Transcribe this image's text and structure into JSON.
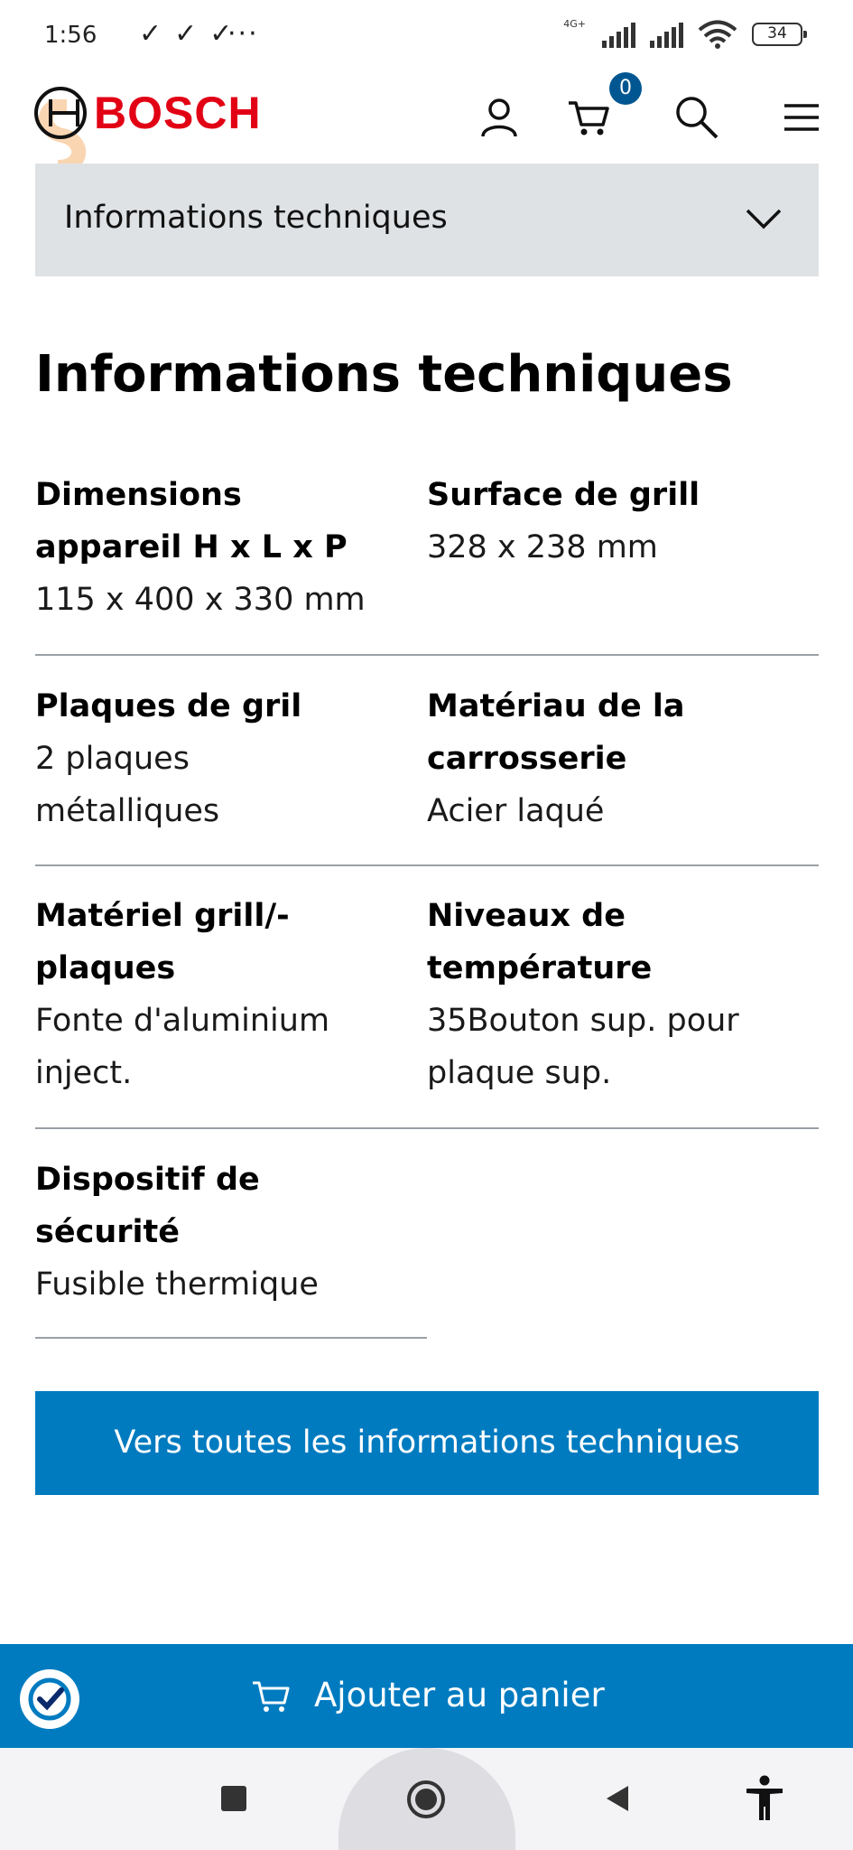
{
  "status_bar": {
    "time": "1:56",
    "network_label": "4G+",
    "battery": "34"
  },
  "header": {
    "brand": "BOSCH",
    "cart_count": "0"
  },
  "accordion": {
    "title": "Informations techniques"
  },
  "section": {
    "title": "Informations techniques",
    "specs": [
      {
        "label": "Dimensions appareil H x L x P",
        "value": "115 x 400 x 330 mm"
      },
      {
        "label": "Surface de grill",
        "value": "328 x 238 mm"
      },
      {
        "label": "Plaques de gril",
        "value": "2 plaques métalliques"
      },
      {
        "label": "Matériau de la carrosserie",
        "value": "Acier laqué"
      },
      {
        "label": "Matériel grill/-plaques",
        "value": "Fonte d'aluminium inject."
      },
      {
        "label": "Niveaux de température",
        "value": "35Bouton sup. pour plaque sup."
      },
      {
        "label": "Dispositif de sécurité",
        "value": "Fusible thermique"
      }
    ]
  },
  "cta": {
    "label": "Vers toutes les informations techniques"
  },
  "sticky": {
    "add_to_cart_label": "Ajouter au panier"
  },
  "colors": {
    "brand_red": "#e20015",
    "primary_blue": "#007bc0",
    "accordion_bg": "#dfe2e5"
  },
  "icons": [
    "user-icon",
    "cart-icon",
    "search-icon",
    "menu-icon",
    "chevron-down-icon",
    "shield-check-icon",
    "accessibility-icon"
  ]
}
